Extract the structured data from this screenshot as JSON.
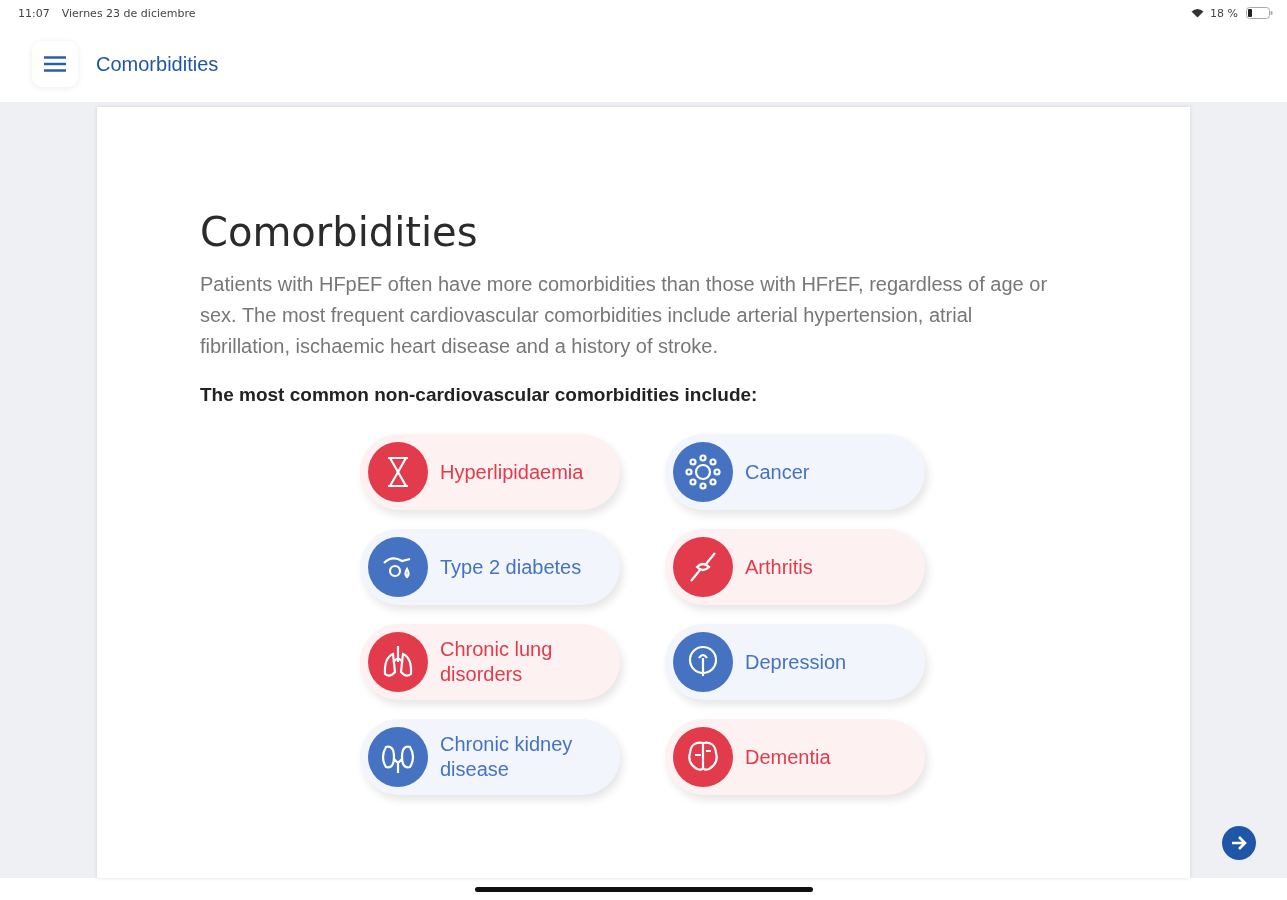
{
  "status_bar": {
    "time": "11:07",
    "date": "Viernes 23 de diciembre",
    "battery": "18 %"
  },
  "header": {
    "title": "Comorbidities"
  },
  "content": {
    "title": "Comorbidities",
    "intro": "Patients with HFpEF often have more comorbidities than those with HFrEF, regardless of age or sex. The most frequent cardiovascular comorbidities include arterial hypertension, atrial fibrillation, ischaemic heart disease and a history of stroke.",
    "subheading": "The most common non-cardiovascular comorbidities include:",
    "items": [
      {
        "label": "Hyperlipidaemia",
        "color": "#e23b4c"
      },
      {
        "label": "Cancer",
        "color": "#4573c2"
      },
      {
        "label": "Type 2 diabetes",
        "color": "#4573c2"
      },
      {
        "label": "Arthritis",
        "color": "#e23b4c"
      },
      {
        "label": "Chronic lung disorders",
        "color": "#e23b4c"
      },
      {
        "label": "Depression",
        "color": "#4573c2"
      },
      {
        "label": "Chronic kidney disease",
        "color": "#4573c2"
      },
      {
        "label": "Dementia",
        "color": "#e23b4c"
      }
    ]
  }
}
